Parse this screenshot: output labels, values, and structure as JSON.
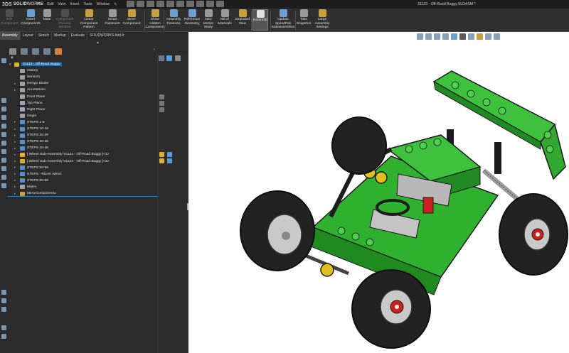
{
  "app": {
    "logo_prefix": "3DS",
    "logo_main": "SOLID",
    "logo_sub": "WORKS",
    "window_title": "31123 - Off-Road Buggy.SLDASM *"
  },
  "menu": [
    "File",
    "Edit",
    "View",
    "Insert",
    "Tools",
    "Window"
  ],
  "ribbon": {
    "buttons": [
      {
        "label": "Edit\nComponent",
        "disabled": true,
        "color": "#777777"
      },
      {
        "label": "Insert\nComponents",
        "disabled": false,
        "color": "#6a9fd4"
      },
      {
        "label": "Mate",
        "disabled": false,
        "color": "#9a9a9a"
      },
      {
        "label": "Component\nPreview\nWindow",
        "disabled": true,
        "color": "#777777"
      },
      {
        "label": "Linear Component\nPattern",
        "disabled": false,
        "color": "#c8a040"
      },
      {
        "label": "Smart\nFasteners",
        "disabled": false,
        "color": "#9a9a9a"
      },
      {
        "label": "Move\nComponent",
        "disabled": false,
        "color": "#c8a040"
      },
      {
        "label": "Show\nHidden\nComponents",
        "disabled": false,
        "color": "#c8a040"
      },
      {
        "label": "Assembly\nFeatures",
        "disabled": false,
        "color": "#6a9fd4"
      },
      {
        "label": "Reference\nGeometry",
        "disabled": false,
        "color": "#6a9fd4"
      },
      {
        "label": "New\nMotion\nStudy",
        "disabled": false,
        "color": "#9a9a9a"
      },
      {
        "label": "Bill of\nMaterials",
        "disabled": false,
        "color": "#9a9a9a"
      },
      {
        "label": "Exploded\nView",
        "disabled": false,
        "color": "#c8a040"
      },
      {
        "label": "Instant3D",
        "disabled": false,
        "active": true,
        "color": "#e0e0e0"
      },
      {
        "label": "Update\nSpeedPak\nSubassemblies",
        "disabled": false,
        "color": "#6a9fd4"
      },
      {
        "label": "Take\nSnapshot",
        "disabled": false,
        "color": "#9a9a9a"
      },
      {
        "label": "Large\nAssembly\nSettings",
        "disabled": false,
        "color": "#c8a040"
      }
    ]
  },
  "tabs": [
    {
      "label": "Assembly",
      "active": true
    },
    {
      "label": "Layout",
      "active": false
    },
    {
      "label": "Sketch",
      "active": false
    },
    {
      "label": "Markup",
      "active": false
    },
    {
      "label": "Evaluate",
      "active": false
    },
    {
      "label": "SOLIDWORKS Add-Ins",
      "active": false
    }
  ],
  "tree": {
    "items": [
      {
        "label": "31123 - Off-Road Buggy",
        "level": 0,
        "expand": "▼",
        "icon": "assembly-icon",
        "color": "#d9b03c",
        "selected": true
      },
      {
        "label": "History",
        "level": 1,
        "expand": "",
        "icon": "history-icon",
        "color": "#a0a0a0"
      },
      {
        "label": "Sensors",
        "level": 1,
        "expand": "",
        "icon": "sensor-icon",
        "color": "#a0a0a0"
      },
      {
        "label": "Design Binder",
        "level": 1,
        "expand": "▸",
        "icon": "binder-icon",
        "color": "#a0a0a0"
      },
      {
        "label": "Annotations",
        "level": 1,
        "expand": "▸",
        "icon": "annotation-icon",
        "color": "#a0a0a0"
      },
      {
        "label": "Front Plane",
        "level": 1,
        "expand": "",
        "icon": "plane-icon",
        "color": "#9aa8b4"
      },
      {
        "label": "Top Plane",
        "level": 1,
        "expand": "",
        "icon": "plane-icon",
        "color": "#9aa8b4"
      },
      {
        "label": "Right Plane",
        "level": 1,
        "expand": "",
        "icon": "plane-icon",
        "color": "#9aa8b4"
      },
      {
        "label": "Origin",
        "level": 1,
        "expand": "",
        "icon": "origin-icon",
        "color": "#a0a0a0"
      },
      {
        "label": "STEPS 1-9",
        "level": 1,
        "expand": "▸",
        "icon": "folder-icon",
        "color": "#5a8fc8"
      },
      {
        "label": "STEPS 10-19",
        "level": 1,
        "expand": "▸",
        "icon": "folder-icon",
        "color": "#5a8fc8"
      },
      {
        "label": "STEPS 20-29",
        "level": 1,
        "expand": "▸",
        "icon": "folder-icon",
        "color": "#5a8fc8"
      },
      {
        "label": "STEPS 30-38",
        "level": 1,
        "expand": "▸",
        "icon": "folder-icon",
        "color": "#5a8fc8"
      },
      {
        "label": "STEPS 40-49",
        "level": 1,
        "expand": "▸",
        "icon": "folder-icon",
        "color": "#5a8fc8"
      },
      {
        "label": "[ Wheel Sub-Assembly^31123 - Off-Road Buggy ]<1>",
        "level": 1,
        "expand": "▸",
        "icon": "subassembly-icon",
        "color": "#d9b03c"
      },
      {
        "label": "[ Wheel Sub-Assembly^31123 - Off-Road Buggy ]<3>",
        "level": 1,
        "expand": "▸",
        "icon": "subassembly-icon",
        "color": "#d9b03c"
      },
      {
        "label": "STEPS 50-59",
        "level": 1,
        "expand": "▸",
        "icon": "folder-icon",
        "color": "#5a8fc8"
      },
      {
        "label": "STEPS - REAR WING",
        "level": 1,
        "expand": "▸",
        "icon": "folder-icon",
        "color": "#5a8fc8"
      },
      {
        "label": "STEPS 60-69",
        "level": 1,
        "expand": "▸",
        "icon": "folder-icon",
        "color": "#5a8fc8"
      },
      {
        "label": "Mates",
        "level": 1,
        "expand": "▸",
        "icon": "mates-icon",
        "color": "#a0a0a0"
      },
      {
        "label": "MirrorComponent1",
        "level": 1,
        "expand": "▸",
        "icon": "mirror-icon",
        "color": "#c8a040"
      }
    ]
  }
}
